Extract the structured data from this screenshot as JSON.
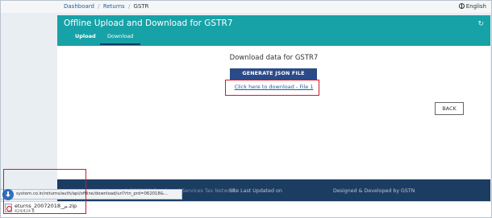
{
  "breadcrumb": {
    "items": [
      "Dashboard",
      "Returns",
      "GSTR"
    ],
    "separator": "/"
  },
  "language": {
    "label": "English",
    "icon": "globe-icon"
  },
  "header": {
    "title": "Offline Upload and Download for GSTR7",
    "refresh_icon": "refresh-icon",
    "tabs": [
      {
        "label": "Upload",
        "active": false
      },
      {
        "label": "Download",
        "active": true
      }
    ],
    "background": "#17a2a7"
  },
  "main": {
    "heading": "Download data for GSTR7",
    "generate_button": "GENERATE JSON FILE",
    "download_link": "Click here to download - File 1",
    "back_button": "BACK"
  },
  "footer": {
    "copyright": "© 2018-19 Goods and Services Tax Network",
    "updated": "Site Last Updated on",
    "developed": "Designed & Developed by GSTN"
  },
  "status_bar": {
    "url": "system.co.in/returns/auth/api/offline/download/url?rtn_prd=062018&..."
  },
  "download_shelf": {
    "file_name": "eturns_20072018_بر.zip",
    "file_size": "424/424 B"
  },
  "colors": {
    "accent": "#17a2a7",
    "primary_button": "#2c4a87",
    "footer": "#1c3d62",
    "highlight": "#d6162a",
    "link": "#1f5f99"
  }
}
